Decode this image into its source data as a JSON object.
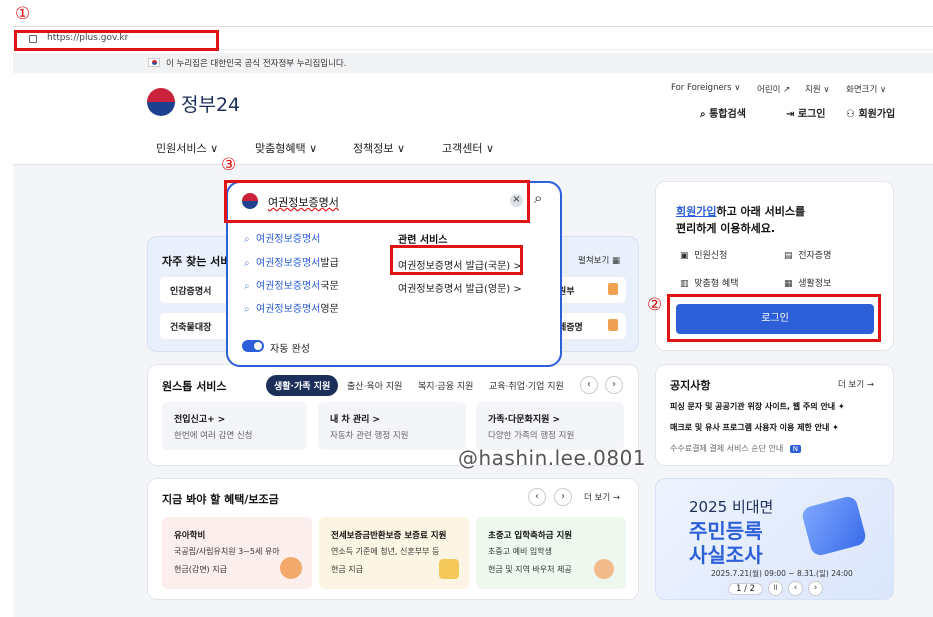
{
  "browser": {
    "url": "https://plus.gov.kr"
  },
  "gov_banner": {
    "text": "이 누리집은 대한민국 공식 전자정부 누리집입니다."
  },
  "header": {
    "logo_text": "정부24",
    "utility": [
      "For Foreigners",
      "어린이",
      "지원",
      "화면크기"
    ],
    "actions": [
      "통합검색",
      "로그인",
      "회원가입"
    ]
  },
  "nav": {
    "items": [
      "민원서비스",
      "맞춤형혜택",
      "정책정보",
      "고객센터"
    ]
  },
  "search": {
    "value": "여권정보증명서",
    "clear_icon": "×",
    "suggestions": [
      {
        "match": "여권정보증명서",
        "rest": ""
      },
      {
        "match": "여권정보증명서",
        "rest": "발급"
      },
      {
        "match": "여권정보증명서",
        "rest": "국문"
      },
      {
        "match": "여권정보증명서",
        "rest": "영문"
      }
    ],
    "related_title": "관련 서비스",
    "related": [
      "여권정보증명서 발급(국문) >",
      "여권정보증명서 발급(영문) >"
    ],
    "autocomplete_label": "자동 완성"
  },
  "frequent": {
    "title": "자주 찾는 서비",
    "expand": "펼쳐보기",
    "items": [
      "인감증명서",
      "건축물대장",
      "원부",
      "체증명"
    ]
  },
  "login_card": {
    "line1_link": "회원가입",
    "line1_rest": "하고 아래 서비스를",
    "line2": "편리하게 이용하세요.",
    "services": [
      "민원신청",
      "전자증명",
      "맞춤형 혜택",
      "생활정보"
    ],
    "button": "로그인"
  },
  "onestop": {
    "title": "원스톱 서비스",
    "tabs": [
      "생활·가족 지원",
      "출산·육아 지원",
      "복지·금융 지원",
      "교육·취업·기업 지원"
    ],
    "tiles": [
      {
        "title": "전입신고+ >",
        "desc": "한번에 여러 감면 신청"
      },
      {
        "title": "내 차 관리 >",
        "desc": "자동차 관련 행정 지원"
      },
      {
        "title": "가족·다문화지원 >",
        "desc": "다양한 가족의 행정 지원"
      }
    ]
  },
  "notice": {
    "title": "공지사항",
    "more": "더 보기 →",
    "items": [
      "피싱 문자 및 공공기관 위장 사이트, 웹 주의 안내",
      "매크로 및 유사 프로그램 사용자 이용 제한 안내",
      "수수료결제 결제 서비스 순단 안내"
    ],
    "new_badge": "N"
  },
  "benefits": {
    "title": "지금 봐야 할 혜택/보조금",
    "more": "더 보기 →",
    "cards": [
      {
        "title": "유아학비",
        "desc": "국공립/사립유치원 3~5세 유아",
        "tag": "현금(감면) 지급",
        "bg": "#fdeeee"
      },
      {
        "title": "전세보증금반환보증 보증료 지원",
        "desc": "연소득 기준에 청년, 신혼부부 등",
        "tag": "현금 지급",
        "bg": "#fdf5e3"
      },
      {
        "title": "초중고 입학축하금 지원",
        "desc": "초중고 예비 입학생",
        "tag": "현금 및 지역 바우처 제공",
        "bg": "#eef8ef"
      }
    ]
  },
  "promo": {
    "line1": "2025 비대면",
    "line2": "주민등록",
    "line3": "사실조사",
    "period": "2025.7.21(월) 09:00 ~ 8.31.(일) 24:00",
    "pager": "1 / 2"
  },
  "watermark": "@hashin.lee.0801",
  "annotations": [
    "①",
    "②",
    "③"
  ],
  "colors": {
    "accent": "#2d5fd8",
    "highlight": "#e01414",
    "navy": "#1c2f5b"
  }
}
